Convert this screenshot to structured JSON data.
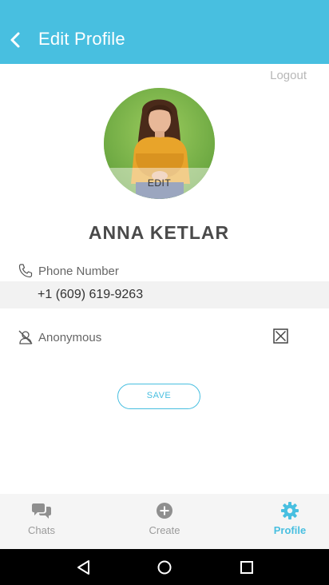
{
  "header": {
    "title": "Edit Profile",
    "back_icon": "chevron-left-icon",
    "background": "#48bfe0"
  },
  "logout_label": "Logout",
  "avatar": {
    "edit_label": "EDIT"
  },
  "profile": {
    "name": "ANNA KETLAR",
    "phone_label": "Phone Number",
    "phone_value": "+1 (609) 619-9263",
    "anonymous_label": "Anonymous",
    "anonymous_checked": true
  },
  "save_label": "SAVE",
  "bottom_nav": {
    "items": [
      {
        "label": "Chats",
        "icon": "chat-bubbles-icon",
        "active": false
      },
      {
        "label": "Create",
        "icon": "plus-circle-icon",
        "active": false
      },
      {
        "label": "Profile",
        "icon": "gear-icon",
        "active": true
      }
    ]
  },
  "colors": {
    "accent": "#48bfe0",
    "nav_inactive": "#9b9b9b"
  }
}
